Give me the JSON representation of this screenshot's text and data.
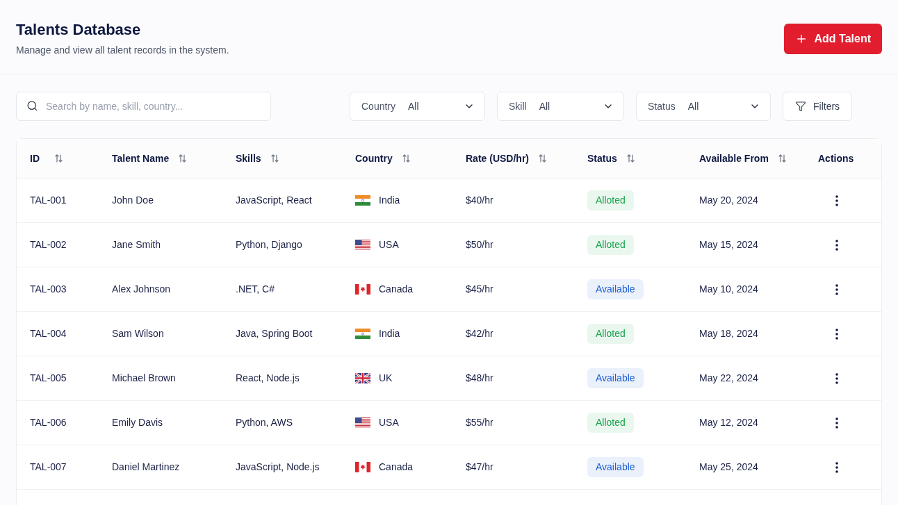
{
  "page": {
    "title": "Talents Database",
    "subtitle": "Manage and view all talent records in the system."
  },
  "add_button": {
    "label": "Add Talent"
  },
  "search": {
    "placeholder": "Search by name, skill, country..."
  },
  "filters": [
    {
      "label": "Country",
      "value": "All"
    },
    {
      "label": "Skill",
      "value": "All"
    },
    {
      "label": "Status",
      "value": "All"
    }
  ],
  "filters_button": {
    "label": "Filters"
  },
  "table": {
    "columns": [
      {
        "label": "ID",
        "sortable": true
      },
      {
        "label": "Talent Name",
        "sortable": true
      },
      {
        "label": "Skills",
        "sortable": true
      },
      {
        "label": "Country",
        "sortable": true
      },
      {
        "label": "Rate (USD/hr)",
        "sortable": true
      },
      {
        "label": "Status",
        "sortable": true
      },
      {
        "label": "Available From",
        "sortable": true
      },
      {
        "label": "Actions",
        "sortable": false
      }
    ],
    "rows": [
      {
        "id": "TAL-001",
        "name": "John Doe",
        "skills": "JavaScript, React",
        "country": {
          "label": "India",
          "kind": "in"
        },
        "rate": "$40/hr",
        "status": {
          "label": "Alloted",
          "color": "#16a34a"
        },
        "available_from": "May 20, 2024"
      },
      {
        "id": "TAL-002",
        "name": "Jane Smith",
        "skills": "Python, Django",
        "country": {
          "label": "USA",
          "kind": "us"
        },
        "rate": "$50/hr",
        "status": {
          "label": "Alloted",
          "color": "#16a34a"
        },
        "available_from": "May 15, 2024"
      },
      {
        "id": "TAL-003",
        "name": "Alex Johnson",
        "skills": ".NET, C#",
        "country": {
          "label": "Canada",
          "kind": "ca"
        },
        "rate": "$45/hr",
        "status": {
          "label": "Available",
          "color": "#1d5fd6"
        },
        "available_from": "May 10, 2024"
      },
      {
        "id": "TAL-004",
        "name": "Sam Wilson",
        "skills": "Java, Spring Boot",
        "country": {
          "label": "India",
          "kind": "in"
        },
        "rate": "$42/hr",
        "status": {
          "label": "Alloted",
          "color": "#16a34a"
        },
        "available_from": "May 18, 2024"
      },
      {
        "id": "TAL-005",
        "name": "Michael Brown",
        "skills": "React, Node.js",
        "country": {
          "label": "UK",
          "kind": "gb"
        },
        "rate": "$48/hr",
        "status": {
          "label": "Available",
          "color": "#1d5fd6"
        },
        "available_from": "May 22, 2024"
      },
      {
        "id": "TAL-006",
        "name": "Emily Davis",
        "skills": "Python, AWS",
        "country": {
          "label": "USA",
          "kind": "us"
        },
        "rate": "$55/hr",
        "status": {
          "label": "Alloted",
          "color": "#16a34a"
        },
        "available_from": "May 12, 2024"
      },
      {
        "id": "TAL-007",
        "name": "Daniel Martinez",
        "skills": "JavaScript, Node.js",
        "country": {
          "label": "Canada",
          "kind": "ca"
        },
        "rate": "$47/hr",
        "status": {
          "label": "Available",
          "color": "#1d5fd6"
        },
        "available_from": "May 25, 2024"
      }
    ]
  }
}
